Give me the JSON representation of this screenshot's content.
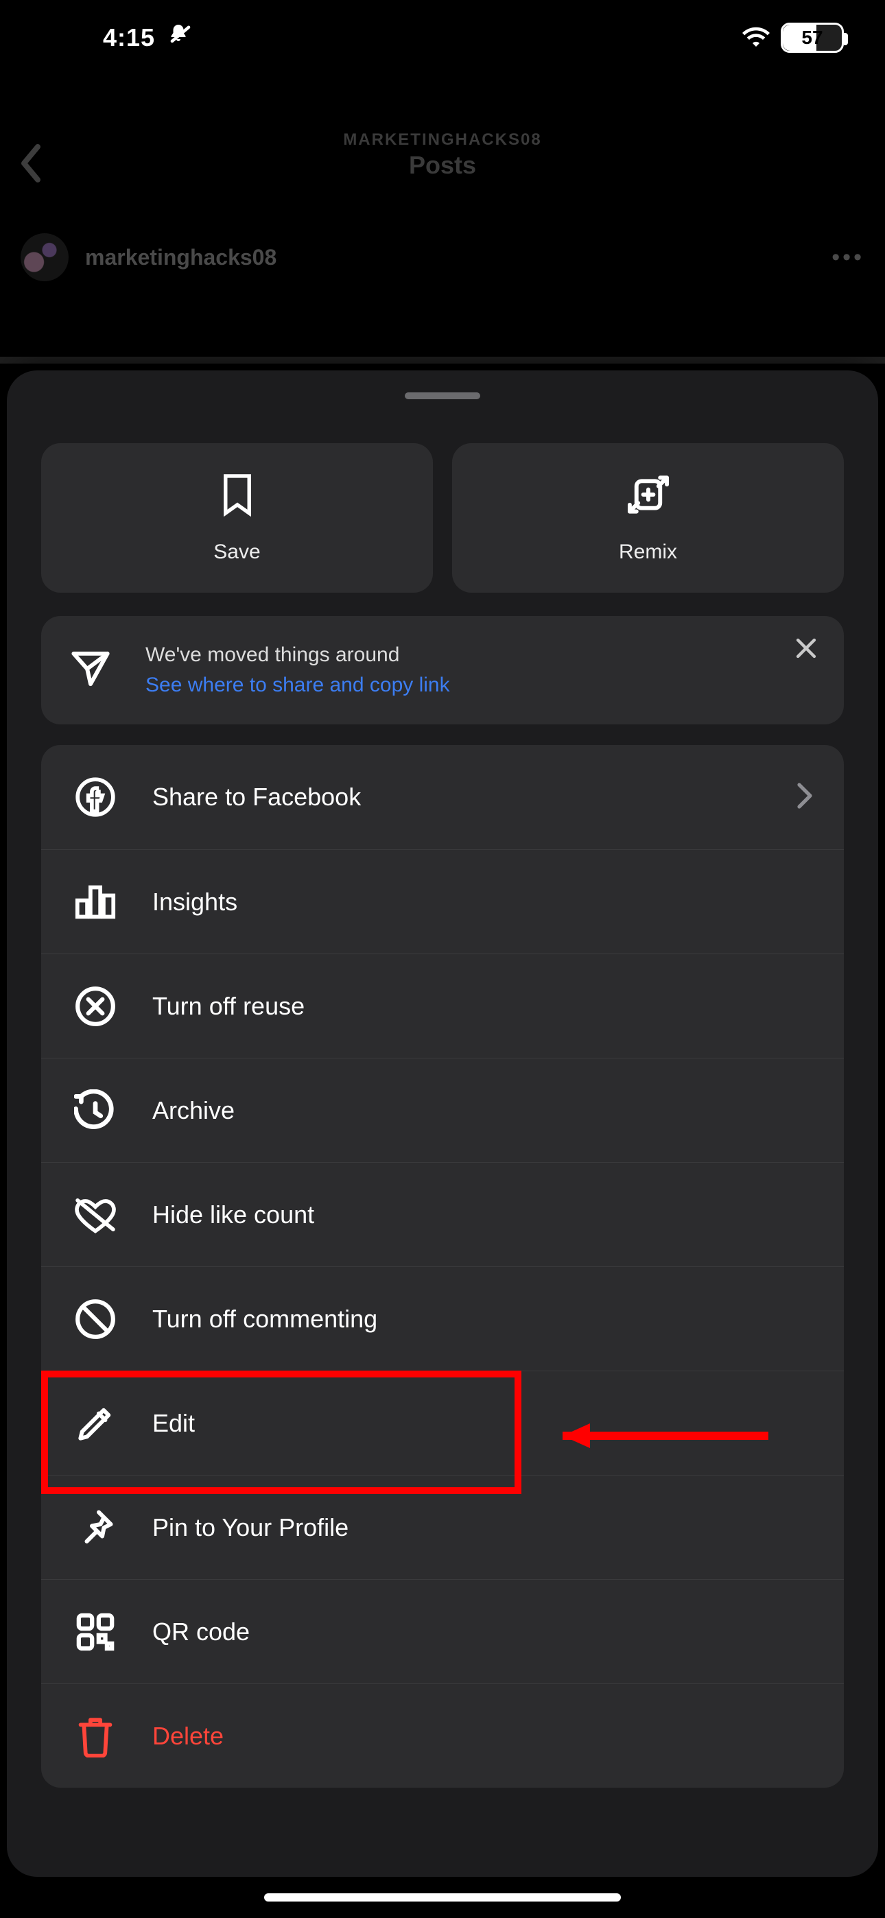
{
  "status": {
    "time": "4:15",
    "battery": "57"
  },
  "header": {
    "overline": "MARKETINGHACKS08",
    "title": "Posts",
    "account": "marketinghacks08"
  },
  "tiles": {
    "save": "Save",
    "remix": "Remix"
  },
  "notice": {
    "line1": "We've moved things around",
    "link": "See where to share and copy link"
  },
  "menu": [
    {
      "label": "Share to Facebook"
    },
    {
      "label": "Insights"
    },
    {
      "label": "Turn off reuse"
    },
    {
      "label": "Archive"
    },
    {
      "label": "Hide like count"
    },
    {
      "label": "Turn off commenting"
    },
    {
      "label": "Edit"
    },
    {
      "label": "Pin to Your Profile"
    },
    {
      "label": "QR code"
    },
    {
      "label": "Delete"
    }
  ]
}
